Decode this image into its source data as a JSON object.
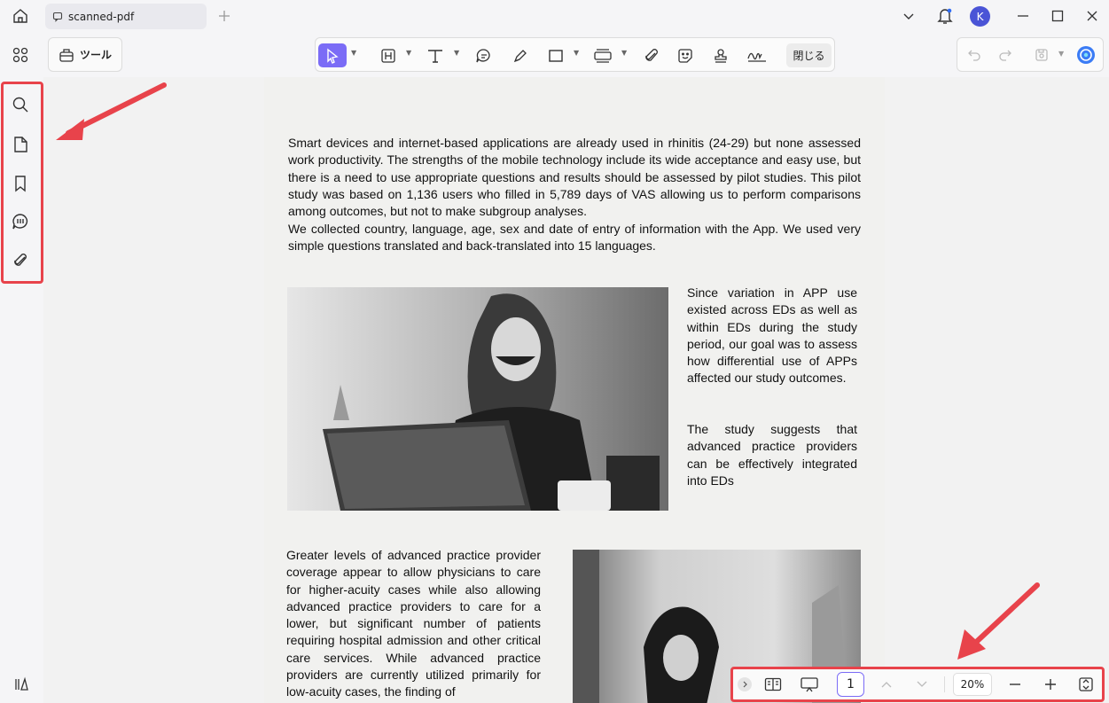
{
  "titlebar": {
    "tab_title": "scanned-pdf",
    "user_initial": "K",
    "avatar_color": "#4a54d6"
  },
  "toolbar": {
    "tools_label": "ツール",
    "close_label": "閉じる",
    "active_color": "#7b6cf6"
  },
  "document": {
    "paragraph1": "Smart devices and internet-based applications are already used in rhinitis (24-29) but none assessed work productivity. The strengths of the mobile technology include its wide acceptance and easy use, but there is a need to use appropriate questions and results should be assessed by pilot studies. This pilot study was based on 1,136 users who filled in 5,789 days of VAS allowing us to perform comparisons among outcomes, but not to make subgroup analyses.",
    "paragraph2": "We collected country, language, age, sex and date of entry of information with the App. We used very simple questions translated and back-translated into 15 languages.",
    "side_text1": "Since variation in APP use existed across EDs as well as within EDs during the study period, our goal was to assess how differential use of APPs affected our study outcomes.",
    "side_text2": "The study suggests that advanced practice providers can be effectively integrated into EDs",
    "left_text": "Greater levels of advanced practice provider coverage appear to allow physicians to care for higher-acuity cases while also allowing advanced practice providers to care for a lower, but significant number of patients requiring hospital admission and other critical care services. While advanced practice providers are currently utilized primarily for low-acuity cases, the finding of"
  },
  "bottom_bar": {
    "page_number": "1",
    "zoom": "20%"
  },
  "annotation_color": "#e8434b"
}
